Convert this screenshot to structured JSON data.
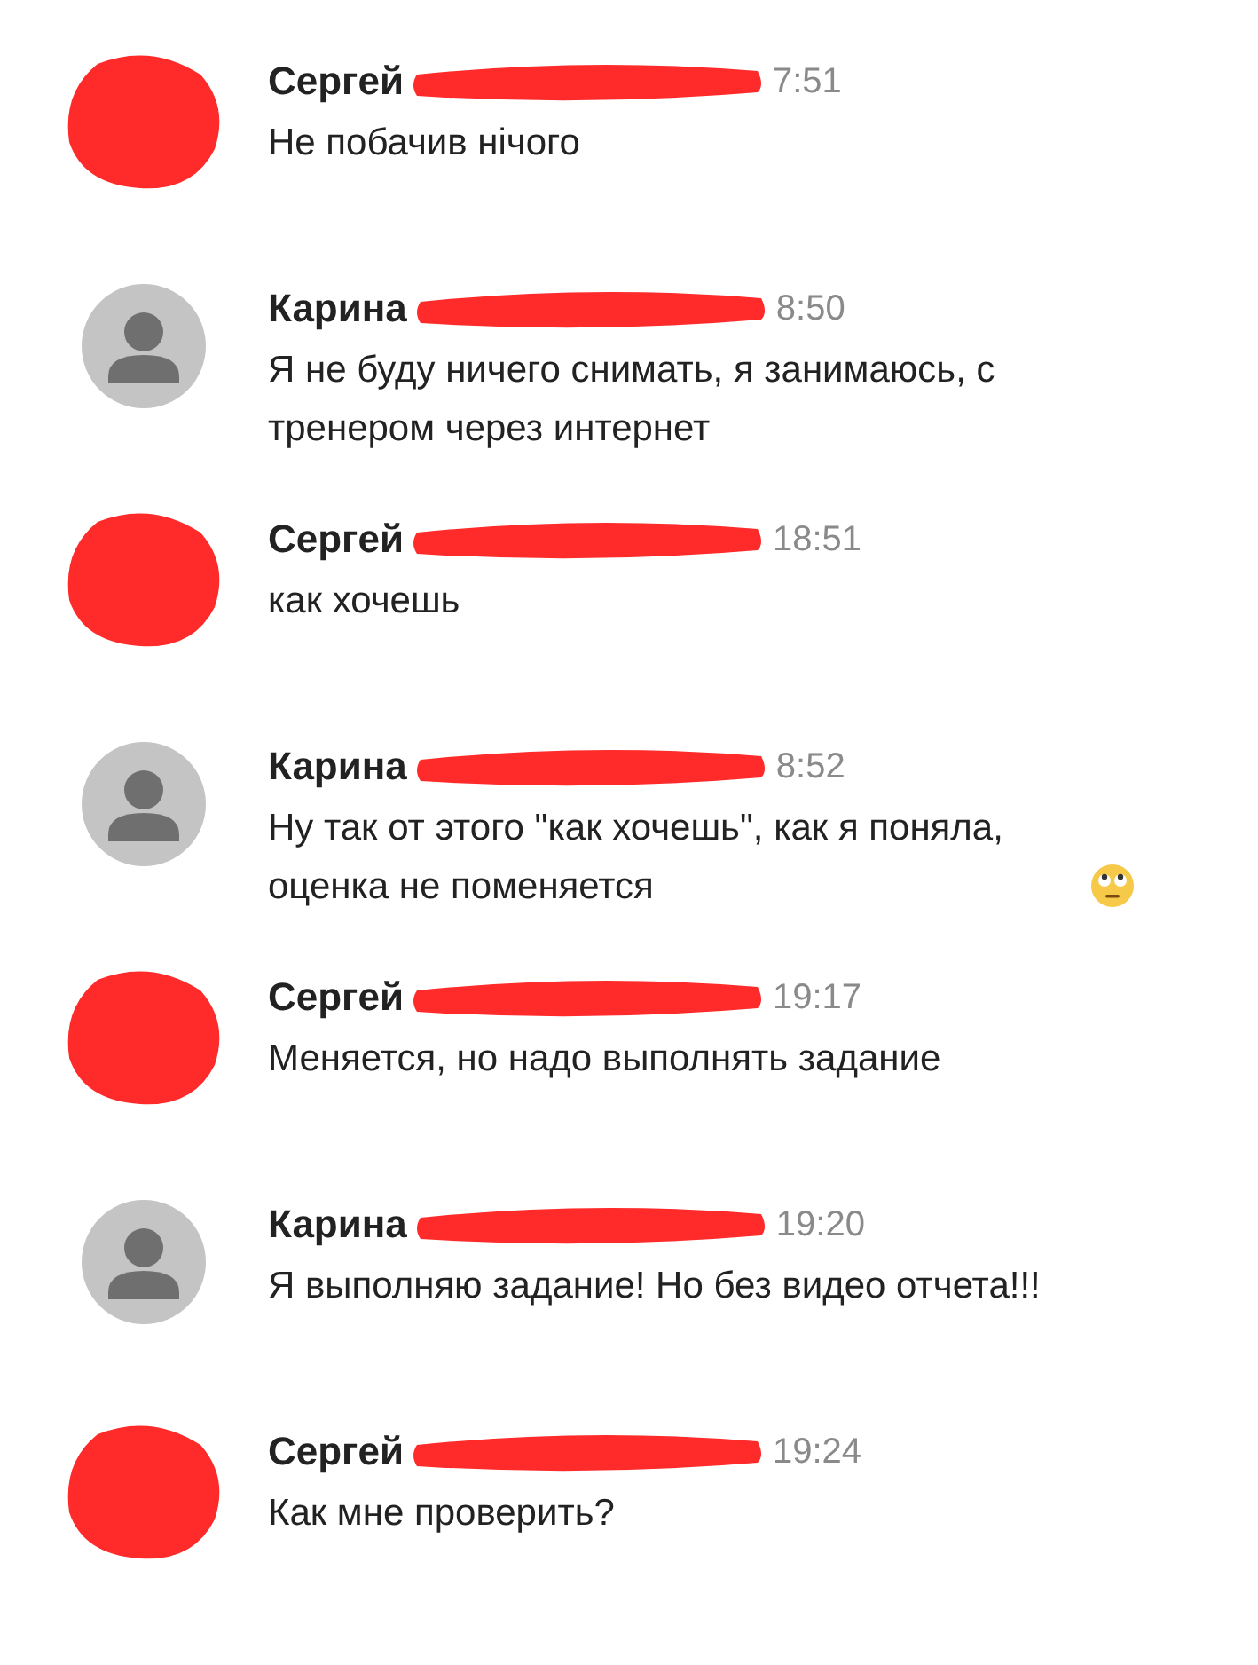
{
  "messages": [
    {
      "author": "Сергей",
      "kind": "redacted",
      "name_redacted": true,
      "time": "7:51",
      "text": "Не побачив нічого",
      "trailing_emoji": false
    },
    {
      "author": "Карина",
      "kind": "default",
      "name_redacted": true,
      "time": "8:50",
      "text": "Я не буду ничего снимать, я занимаюсь, с тренером через интернет",
      "trailing_emoji": false
    },
    {
      "author": "Сергей",
      "kind": "redacted",
      "name_redacted": true,
      "time": "18:51",
      "text": "как хочешь",
      "trailing_emoji": false
    },
    {
      "author": "Карина",
      "kind": "default",
      "name_redacted": true,
      "time": "8:52",
      "text": "Ну так от этого \"как хочешь\", как я поняла, оценка не поменяется",
      "trailing_emoji": true
    },
    {
      "author": "Сергей",
      "kind": "redacted",
      "name_redacted": true,
      "time": "19:17",
      "text": "Меняется, но надо выполнять задание",
      "trailing_emoji": false
    },
    {
      "author": "Карина",
      "kind": "default",
      "name_redacted": true,
      "time": "19:20",
      "text": "Я выполняю задание! Но без видео отчета!!!",
      "trailing_emoji": false
    },
    {
      "author": "Сергей",
      "kind": "redacted",
      "name_redacted": true,
      "time": "19:24",
      "text": "Как мне проверить?",
      "trailing_emoji": false
    }
  ]
}
